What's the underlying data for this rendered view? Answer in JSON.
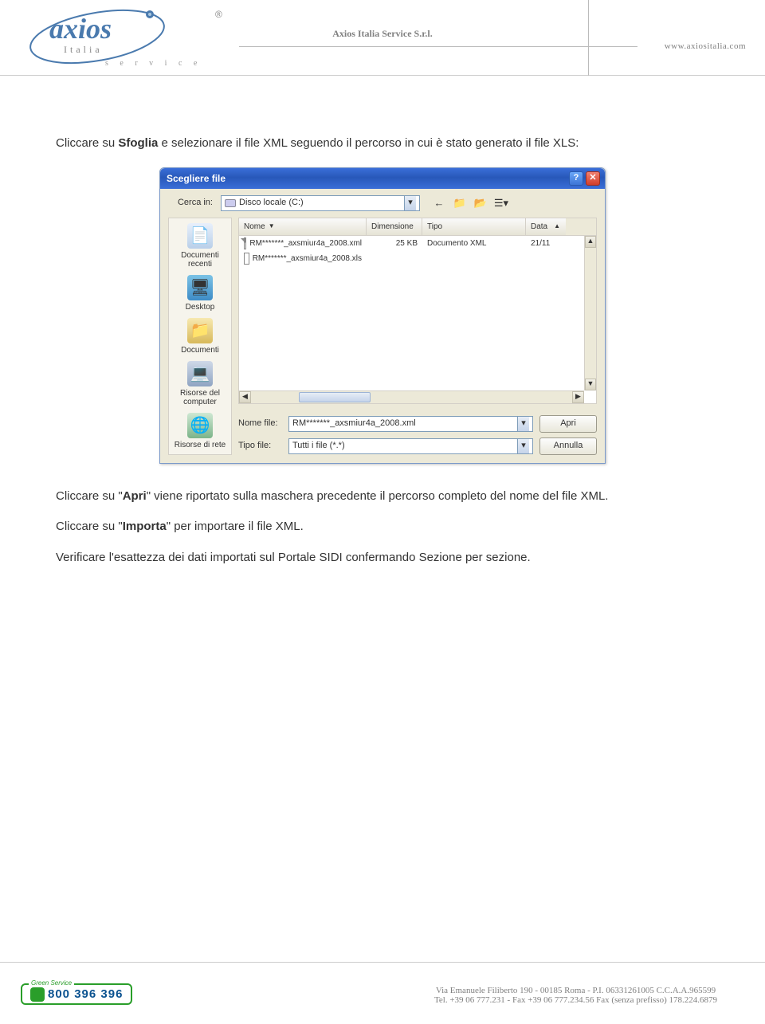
{
  "header": {
    "company": "Axios Italia Service S.r.l.",
    "website": "www.axiositalia.com",
    "logo": {
      "brand": "axios",
      "country": "Italia",
      "sub": "s e r v i c e",
      "reg": "®"
    }
  },
  "body": {
    "p1_pre": "Cliccare su ",
    "p1_bold": "Sfoglia",
    "p1_post": " e selezionare il file XML seguendo il percorso in cui è stato generato il file XLS:",
    "p2_pre": "Cliccare su \"",
    "p2_bold": "Apri",
    "p2_post": "\" viene riportato sulla maschera precedente il percorso completo del nome del file XML.",
    "p3_pre": "Cliccare su \"",
    "p3_bold": "Importa",
    "p3_post": "\" per importare il file XML.",
    "p4": "Verificare l'esattezza dei dati importati sul Portale SIDI confermando Sezione per sezione."
  },
  "dialog": {
    "title": "Scegliere file",
    "lookin_label": "Cerca in:",
    "lookin_value": "Disco locale (C:)",
    "columns": {
      "name": "Nome",
      "size": "Dimensione",
      "type": "Tipo",
      "date": "Data"
    },
    "files": [
      {
        "name": "RM*******_axsmiur4a_2008.xml",
        "size": "25 KB",
        "type": "Documento XML",
        "date": "21/11"
      },
      {
        "name": "RM*******_axsmiur4a_2008.xls",
        "size": "",
        "type": "",
        "date": ""
      }
    ],
    "places": {
      "recent": "Documenti recenti",
      "desktop": "Desktop",
      "documents": "Documenti",
      "computer": "Risorse del computer",
      "network": "Risorse di rete"
    },
    "filename_label": "Nome file:",
    "filename_value": "RM*******_axsmiur4a_2008.xml",
    "filetype_label": "Tipo file:",
    "filetype_value": "Tutti i file (*.*)",
    "open_btn": "Apri",
    "cancel_btn": "Annulla"
  },
  "footer": {
    "green_label": "Green Service",
    "phone": "800 396 396",
    "line1": "Via Emanuele Filiberto 190 - 00185 Roma - P.I. 06331261005 C.C.A.A.965599",
    "line2": "Tel. +39 06 777.231 - Fax +39 06 777.234.56 Fax (senza prefisso) 178.224.6879"
  }
}
